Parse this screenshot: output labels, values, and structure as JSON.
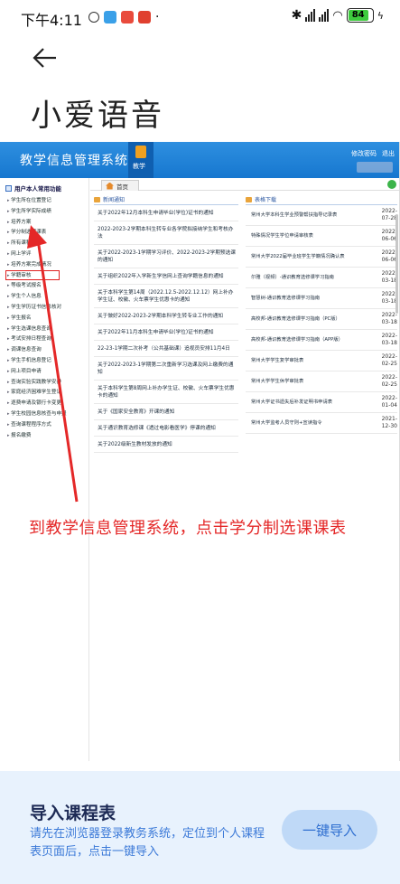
{
  "status_bar": {
    "time": "下午4:11",
    "battery": "84",
    "network": "HD"
  },
  "header": {
    "back_icon": "arrow-left-icon",
    "title": "小爱语音"
  },
  "screenshot": {
    "system_title": "教学信息管理系统",
    "tab_label": "教学",
    "top_links": [
      "修改密码",
      "退出"
    ],
    "sidebar": {
      "header": "用户本人常用功能",
      "items": [
        "学生所在位置登记",
        "学生所学实际成绩",
        "培养方案",
        "学分制选课课表",
        "所有课程信息",
        "网上学评",
        "培养方案完成情况",
        "学籍审核",
        "等级考试报名",
        "学生个人信息",
        "学生学历证书信息核对",
        "学生报名",
        "学生选课信息查询",
        "考试安排日程查询",
        "调课信息查询",
        "学生手机信息登记",
        "网上项目申请",
        "查询实验实践教学安排",
        "家庭经济困难学生登记",
        "逐费申请及银行卡变更",
        "学生校园信息核查与申报",
        "查询课程程序方式",
        "报名缴费"
      ]
    },
    "home_tab": "首页",
    "news": {
      "header": "新闻通知",
      "items": [
        "关于2022年12月本科生申请毕业(学位)证书的通知",
        "2022-2023-2学期本科生转专业各学院拟接纳学生和考核办法",
        "关于2022-2023-1学期学习评价、2022-2023-2学期预选课的通知",
        "关于组织2022年入学新生学信网上查询学籍信息的通知",
        "关于本科学生第14周（2022.12.5-2022.12.12）网上补办学生证、校徽、火车票学生优惠卡的通知",
        "关于做好2022-2023-2学期本科学生转专业工作的通知",
        "关于2022年11月本科生申请毕业(学位)证书的通知",
        "22-23-1学期二次补考（公共基础课）追视员安排11月4日",
        "关于2022-2023-1学期第二次重新学习选课及网上缴费的通知",
        "关于本科学生第8周网上补办学生证、校徽、火车票学生优惠卡的通知",
        "关于《国家安全教育》开课的通知",
        "关于通识教育选修课《透过电影看医学》停课的通知",
        "关于2022级新生教材发放的通知"
      ]
    },
    "downloads": {
      "header": "表格下载",
      "items": [
        {
          "title": "常州大学本科生学业预警帮扶指导记录表",
          "date": "2022-07-28"
        },
        {
          "title": "特殊情况学生学位申请审核表",
          "date": "2022-06-06"
        },
        {
          "title": "常州大学2022届毕业班学生学籍情况确认表",
          "date": "2022-06-06"
        },
        {
          "title": "尔雅（视频）-通识教育选修课学习指南",
          "date": "2022-03-18"
        },
        {
          "title": "智慧树-通识教育选修课学习指南",
          "date": "2022-03-18"
        },
        {
          "title": "高校邦-通识教育选修课学习指南（PC版）",
          "date": "2022-03-18"
        },
        {
          "title": "高校邦-通识教育选修课学习指南（APP版）",
          "date": "2022-03-18"
        },
        {
          "title": "常州大学学生复学审批表",
          "date": "2022-02-25"
        },
        {
          "title": "常州大学学生休学审批表",
          "date": "2022-02-25"
        },
        {
          "title": "常州大学证书遗失后补发证明书申请表",
          "date": "2022-01-04"
        },
        {
          "title": "常州大学监考人员守则+宣读指令",
          "date": "2021-12-30"
        }
      ]
    }
  },
  "annotation": {
    "text": "到教学信息管理系统，点击学分制选课课表",
    "color": "#e42828"
  },
  "bottom_card": {
    "title": "导入课程表",
    "description": "请先在浏览器登录教务系统，定位到个人课程表页面后，点击一键导入",
    "button_label": "一键导入"
  },
  "colors": {
    "accent": "#2f6fd0",
    "ims_header": "#1677cf",
    "card_bg": "#e8f2fd"
  }
}
